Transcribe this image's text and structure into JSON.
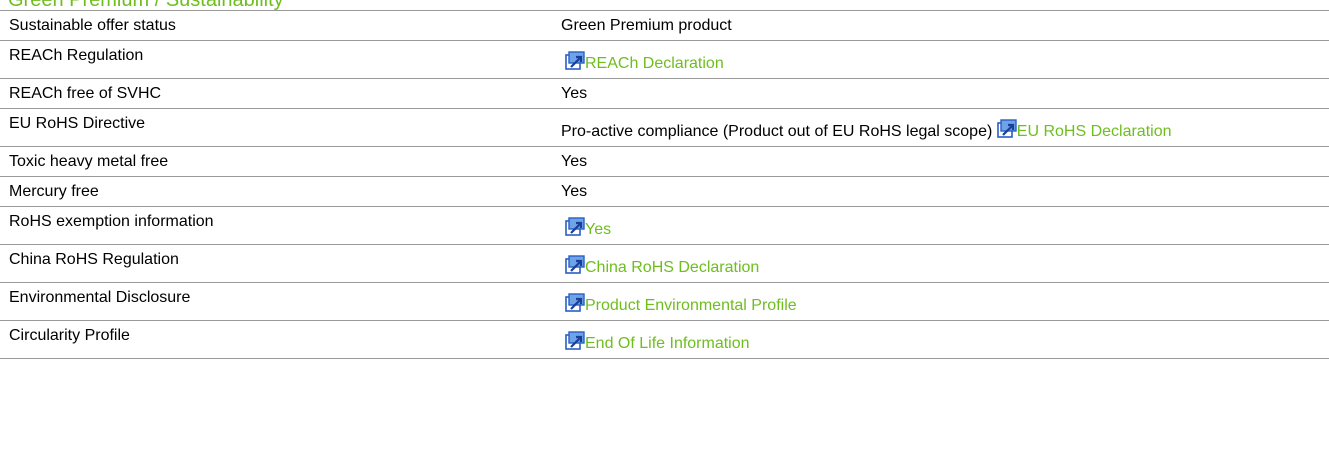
{
  "section": {
    "title": "Green Premium / Sustainability"
  },
  "rows": [
    {
      "label": "Sustainable offer status",
      "value": "Green Premium product"
    },
    {
      "label": "REACh Regulation",
      "link_text": "REACh Declaration"
    },
    {
      "label": "REACh free of SVHC",
      "value": "Yes"
    },
    {
      "label": "EU RoHS Directive",
      "value": "Pro-active compliance (Product out of EU RoHS legal scope)",
      "link_text": "EU RoHS Declaration"
    },
    {
      "label": "Toxic heavy metal free",
      "value": "Yes"
    },
    {
      "label": "Mercury free",
      "value": "Yes"
    },
    {
      "label": "RoHS exemption information",
      "link_text": "Yes"
    },
    {
      "label": "China RoHS Regulation",
      "link_text": "China RoHS Declaration"
    },
    {
      "label": "Environmental Disclosure",
      "link_text": "Product Environmental Profile"
    },
    {
      "label": "Circularity Profile",
      "link_text": "End Of Life Information"
    }
  ],
  "colors": {
    "link": "#6ebe1e",
    "border": "#9a9a9a",
    "icon_blue": "#2a5fc4"
  },
  "icons": {
    "external_link": "external-link-icon"
  }
}
